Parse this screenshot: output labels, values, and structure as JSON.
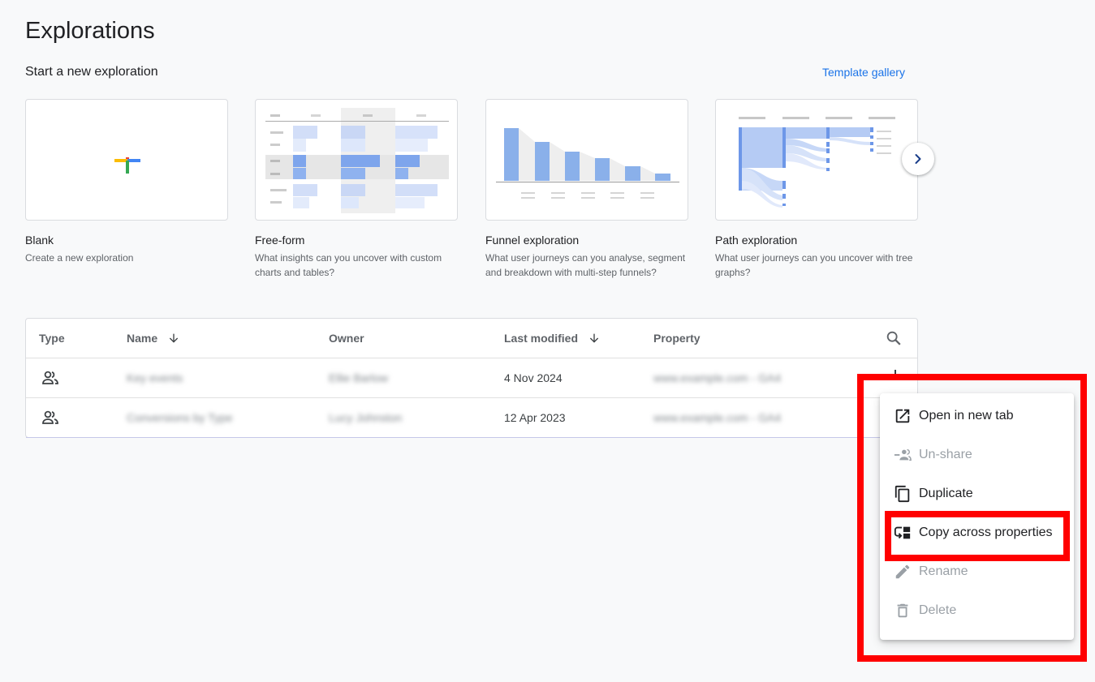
{
  "page": {
    "title": "Explorations"
  },
  "new_exploration": {
    "heading": "Start a new exploration",
    "template_gallery": "Template gallery",
    "cards": [
      {
        "label": "Blank",
        "description": "Create a new exploration"
      },
      {
        "label": "Free-form",
        "description": "What insights can you uncover with custom charts and tables?"
      },
      {
        "label": "Funnel exploration",
        "description": "What user journeys can you analyse, segment and breakdown with multi-step funnels?"
      },
      {
        "label": "Path exploration",
        "description": "What user journeys can you uncover with tree graphs?"
      }
    ]
  },
  "table": {
    "headers": {
      "type": "Type",
      "name": "Name",
      "owner": "Owner",
      "last_modified": "Last modified",
      "property": "Property"
    },
    "rows": [
      {
        "name": "Key events",
        "owner": "Ellie Barlow",
        "last_modified": "4 Nov 2024",
        "property": "www.example.com - GA4"
      },
      {
        "name": "Conversions by Type",
        "owner": "Lucy Johnston",
        "last_modified": "12 Apr 2023",
        "property": "www.example.com - GA4"
      }
    ]
  },
  "context_menu": {
    "items": [
      {
        "label": "Open in new tab",
        "icon": "open-in-new-icon",
        "enabled": true
      },
      {
        "label": "Un-share",
        "icon": "unshare-icon",
        "enabled": false
      },
      {
        "label": "Duplicate",
        "icon": "duplicate-icon",
        "enabled": true
      },
      {
        "label": "Copy across properties",
        "icon": "copy-across-icon",
        "enabled": true
      },
      {
        "label": "Rename",
        "icon": "pencil-icon",
        "enabled": false
      },
      {
        "label": "Delete",
        "icon": "trash-icon",
        "enabled": false
      }
    ]
  },
  "colors": {
    "accent": "#1a73e8",
    "highlight": "#ff0000",
    "chart_blue": "#8ab0ea"
  }
}
